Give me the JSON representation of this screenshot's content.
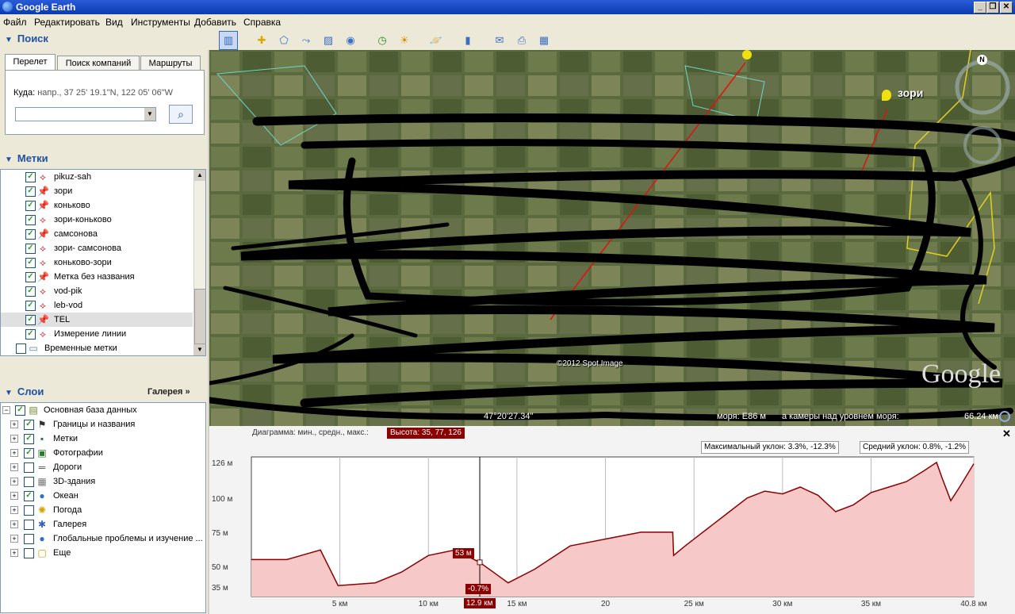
{
  "window": {
    "title": "Google Earth"
  },
  "menu": [
    "Файл",
    "Редактировать",
    "Вид",
    "Инструменты",
    "Добавить",
    "Справка"
  ],
  "search": {
    "header": "Поиск",
    "tabs": [
      "Перелет",
      "Поиск компаний",
      "Маршруты"
    ],
    "fly_label": "Куда:",
    "fly_hint": "напр., 37 25' 19.1\"N, 122 05' 06\"W",
    "input_value": ""
  },
  "places": {
    "header": "Метки",
    "items": [
      {
        "label": "pikuz-sah",
        "icon": "path-icon"
      },
      {
        "label": "зори",
        "icon": "pushpin-icon"
      },
      {
        "label": "коньково",
        "icon": "pushpin-icon"
      },
      {
        "label": "зори-коньково",
        "icon": "path-icon"
      },
      {
        "label": "самсонова",
        "icon": "pushpin-icon"
      },
      {
        "label": "зори- самсонова",
        "icon": "path-icon"
      },
      {
        "label": "коньково-зори",
        "icon": "path-icon"
      },
      {
        "label": "Метка без названия",
        "icon": "pushpin-icon"
      },
      {
        "label": "vod-pik",
        "icon": "path-icon"
      },
      {
        "label": "leb-vod",
        "icon": "path-icon"
      },
      {
        "label": "TEL",
        "icon": "pushpin-icon",
        "selected": true
      },
      {
        "label": "Измерение линии",
        "icon": "path-icon"
      }
    ],
    "temp_folder": "Временные метки"
  },
  "gallery_button": "Галерея »",
  "layers": {
    "header": "Слои",
    "root": "Основная база данных",
    "items": [
      {
        "label": "Границы и названия",
        "checked": true,
        "icon": "flag-icon"
      },
      {
        "label": "Метки",
        "checked": true,
        "icon": "placemark-icon"
      },
      {
        "label": "Фотографии",
        "checked": true,
        "icon": "photo-icon"
      },
      {
        "label": "Дороги",
        "checked": false,
        "icon": "road-icon"
      },
      {
        "label": "3D-здания",
        "checked": false,
        "icon": "building-icon"
      },
      {
        "label": "Океан",
        "checked": true,
        "icon": "globe-icon"
      },
      {
        "label": "Погода",
        "checked": false,
        "icon": "weather-icon"
      },
      {
        "label": "Галерея",
        "checked": false,
        "icon": "gallery-icon"
      },
      {
        "label": "Глобальные проблемы и изучение ...",
        "checked": false,
        "icon": "globe-icon"
      },
      {
        "label": "Еще",
        "checked": false,
        "icon": "more-icon"
      }
    ]
  },
  "map": {
    "labels": {
      "zori": "зори",
      "compass_n": "N",
      "status_coord": "47°20'27.34\"",
      "status_alt": "моря: E86 м",
      "status_cam": "а камеры над уровнем моря:",
      "status_km": "66.24 км",
      "copyright": "©2012 Spot Image",
      "google": "Google"
    }
  },
  "profile": {
    "header_prefix": "Диаграмма: мин., средн., макс.:",
    "height_label": "Высота: 35, 77, 126",
    "slope_max": "Максимальный уклон: 3.3%, -12.3%",
    "slope_avg": "Средний уклон: 0.8%, -1.2%",
    "cursor_value": "53 м",
    "cursor_slope": "-0.7%",
    "cursor_dist": "12.9 км",
    "close": "✕"
  },
  "chart_data": {
    "type": "area",
    "ylabel": "",
    "xlabel": "",
    "x_ticks": [
      "5 км",
      "10 км",
      "15 км",
      "20",
      "25 км",
      "30 км",
      "35 км",
      "40.8 км"
    ],
    "x_tick_values": [
      5,
      10,
      15,
      20,
      25,
      30,
      35,
      40.8
    ],
    "y_ticks": [
      "35 м",
      "50 м",
      "75 м",
      "100 м",
      "126 м"
    ],
    "y_tick_values": [
      35,
      50,
      75,
      100,
      126
    ],
    "xlim": [
      0,
      40.8
    ],
    "ylim": [
      28,
      130
    ],
    "x": [
      0,
      2,
      3.9,
      4.9,
      7,
      8.5,
      10,
      11.5,
      12.9,
      14.5,
      16,
      18,
      20,
      22,
      23.8,
      23.85,
      24.5,
      26,
      27,
      28,
      29,
      30,
      31,
      32,
      33,
      34,
      35,
      36,
      37,
      38,
      38.7,
      39,
      39.5,
      40,
      40.8
    ],
    "y": [
      55,
      55,
      62,
      36,
      38,
      46,
      58,
      62,
      53,
      38,
      48,
      65,
      70,
      75,
      75,
      58,
      65,
      80,
      90,
      100,
      105,
      103,
      108,
      102,
      90,
      95,
      104,
      108,
      112,
      120,
      126,
      115,
      98,
      108,
      125
    ],
    "grid": true,
    "color": "#8b0000",
    "fill": "#f7c8c8"
  }
}
